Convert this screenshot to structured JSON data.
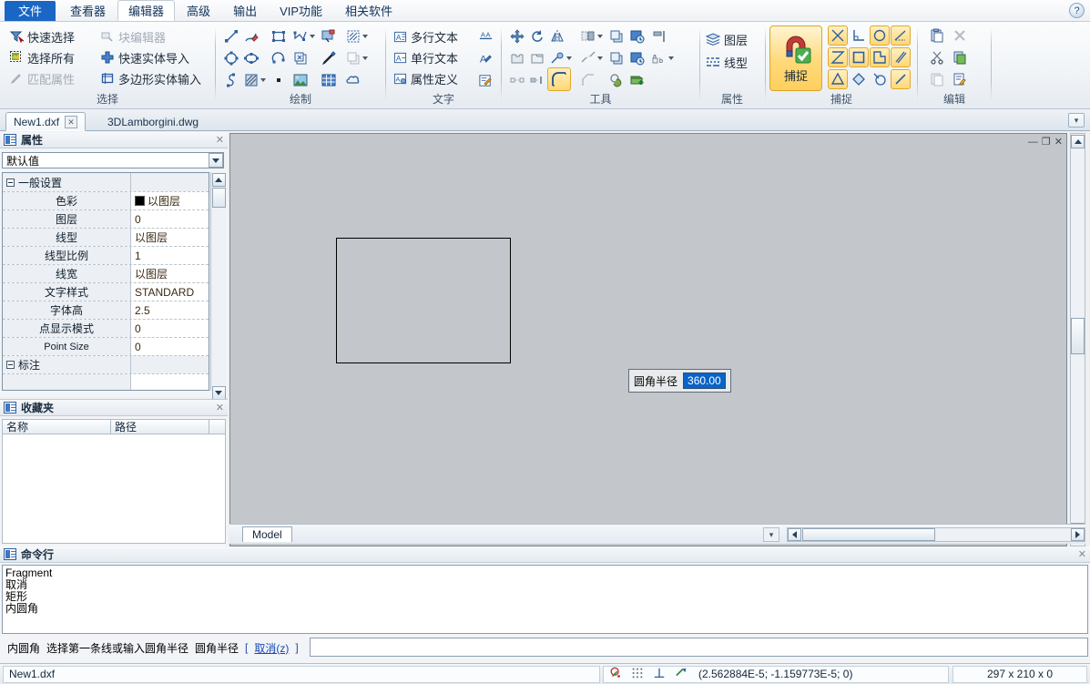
{
  "menubar": {
    "tabs": [
      {
        "label": "文件",
        "state": "file"
      },
      {
        "label": "查看器",
        "state": "normal"
      },
      {
        "label": "编辑器",
        "state": "active"
      },
      {
        "label": "高级",
        "state": "normal"
      },
      {
        "label": "输出",
        "state": "normal"
      },
      {
        "label": "VIP功能",
        "state": "normal"
      },
      {
        "label": "相关软件",
        "state": "normal"
      }
    ],
    "help_label": "?"
  },
  "ribbon": {
    "groups": [
      {
        "name": "select",
        "label": "选择",
        "items": [
          {
            "label": "快速选择",
            "icon": "quick-select-icon",
            "dim": false
          },
          {
            "label": "选择所有",
            "icon": "select-all-icon",
            "dim": false
          },
          {
            "label": "匹配属性",
            "icon": "match-properties-icon",
            "dim": true
          },
          {
            "label": "块编辑器",
            "icon": "block-editor-icon",
            "dim": true
          },
          {
            "label": "快速实体导入",
            "icon": "quick-entity-import-icon",
            "dim": false
          },
          {
            "label": "多边形实体输入",
            "icon": "polygon-entity-input-icon",
            "dim": false
          }
        ]
      },
      {
        "name": "draw",
        "label": "绘制",
        "icons": [
          "line-icon",
          "polyline-icon",
          "rectangle-icon",
          "spline-icon",
          "block-insert-icon",
          "hatch-boundary-icon",
          "circle-icon",
          "ellipse-icon",
          "arc-icon",
          "block-icon",
          "brush-icon",
          "copy-shape-icon",
          "curve-icon",
          "hatch-icon",
          "point-icon",
          "image-icon",
          "table-icon",
          "revision-cloud-icon"
        ]
      },
      {
        "name": "text",
        "label": "文字",
        "items": [
          {
            "label": "多行文本",
            "icon": "mtext-icon"
          },
          {
            "label": "单行文本",
            "icon": "text-icon"
          },
          {
            "label": "属性定义",
            "icon": "attribute-define-icon"
          }
        ],
        "icons": [
          "text-align-icon",
          "text-style-icon",
          "text-edit-icon"
        ]
      },
      {
        "name": "tools",
        "label": "工具",
        "icons": [
          "move-icon",
          "rotate-icon",
          "mirror-icon",
          "trim-icon",
          "copy-icon",
          "scale-rotate-icon",
          "align-icon",
          "extend-icon",
          "stretch-icon",
          "explode-icon",
          "break-icon",
          "array-icon",
          "offset-rotate-icon",
          "layout-icon",
          "break-at-point-icon",
          "break-line-icon",
          "fillet-icon",
          "chamfer-icon",
          "union-icon",
          "add-library-icon"
        ],
        "selected_icon": "fillet-icon"
      },
      {
        "name": "properties",
        "label": "属性",
        "items": [
          {
            "label": "图层",
            "icon": "layers-icon"
          },
          {
            "label": "线型",
            "icon": "linetype-icon"
          }
        ]
      },
      {
        "name": "snap",
        "label": "捕捉",
        "big_button": {
          "label": "捕捉",
          "icon": "magnet-snap-icon",
          "active": true
        },
        "icons": [
          "snap-intersection-icon",
          "snap-perpendicular-icon",
          "snap-center-icon",
          "snap-angle-icon",
          "snap-apparent-icon",
          "snap-midpoint-icon",
          "snap-node-icon",
          "snap-parallel-icon",
          "snap-triangle-icon",
          "snap-quadrant-icon",
          "snap-tangent-icon",
          "snap-nearest-icon"
        ]
      },
      {
        "name": "edit",
        "label": "编辑",
        "icons": [
          "paste-icon",
          "delete-icon",
          "cut-icon",
          "paste-special-icon",
          "copy-clip-icon",
          "clear-format-icon"
        ]
      }
    ]
  },
  "doctabs": {
    "tabs": [
      {
        "label": "New1.dxf",
        "active": true,
        "close": "✕"
      },
      {
        "label": "3DLamborgini.dwg",
        "active": false,
        "close": ""
      }
    ],
    "overflow": "▾"
  },
  "properties_panel": {
    "title": "属性",
    "close": "✕",
    "selector_value": "默认值",
    "rows": [
      {
        "name": "一般设置",
        "value": "",
        "type": "group"
      },
      {
        "name": "色彩",
        "value": "以图层",
        "type": "color"
      },
      {
        "name": "图层",
        "value": "0",
        "type": "text"
      },
      {
        "name": "线型",
        "value": "以图层",
        "type": "text"
      },
      {
        "name": "线型比例",
        "value": "1",
        "type": "text"
      },
      {
        "name": "线宽",
        "value": "以图层",
        "type": "text"
      },
      {
        "name": "文字样式",
        "value": "STANDARD",
        "type": "text"
      },
      {
        "name": "字体高",
        "value": "2.5",
        "type": "text"
      },
      {
        "name": "点显示模式",
        "value": "0",
        "type": "text"
      },
      {
        "name": "Point Size",
        "value": "0",
        "type": "latin"
      },
      {
        "name": "标注",
        "value": "",
        "type": "group"
      }
    ]
  },
  "favorites_panel": {
    "title": "收藏夹",
    "close": "✕",
    "columns": [
      "名称",
      "路径"
    ],
    "rows": []
  },
  "canvas": {
    "window_controls": {
      "minimize": "—",
      "restore": "❐",
      "close": "✕"
    },
    "fillet_dialog": {
      "label": "圆角半径",
      "value": "360.00"
    },
    "model_tab": "Model",
    "background_color": "#c3c7cb"
  },
  "command_panel": {
    "title": "命令行",
    "close": "✕",
    "history": [
      "Fragment",
      "取消",
      "矩形",
      "内圆角"
    ],
    "prompt_command": "内圆角",
    "prompt_text": "选择第一条线或输入圆角半径",
    "prompt_param": "圆角半径",
    "bracket_open": "[",
    "option_link": "取消(z)",
    "bracket_close": "]",
    "input_value": ""
  },
  "statusbar": {
    "file_name": "New1.dxf",
    "toggles": [
      "snap-osnap-icon",
      "grid-icon",
      "ortho-icon",
      "polar-icon"
    ],
    "coordinates": "(2.562884E-5; -1.159773E-5; 0)",
    "paper_size": "297 x 210 x 0"
  }
}
